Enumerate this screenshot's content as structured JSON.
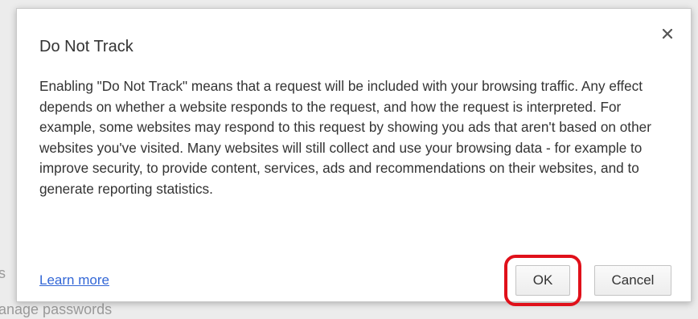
{
  "background": {
    "fragment_bottom": "anage passwords",
    "fragment_mid": "s"
  },
  "dialog": {
    "title": "Do Not Track",
    "close_icon": "close-icon",
    "body": "Enabling \"Do Not Track\" means that a request will be included with your browsing traffic. Any effect depends on whether a website responds to the request, and how the request is interpreted. For example, some websites may respond to this request by showing you ads that aren't based on other websites you've visited. Many websites will still collect and use your browsing data - for example to improve security, to provide content, services, ads and recommendations on their websites, and to generate reporting statistics.",
    "learn_more_label": "Learn more",
    "ok_label": "OK",
    "cancel_label": "Cancel"
  },
  "colors": {
    "link": "#3367d6",
    "highlight": "#e0101a",
    "text": "#333333"
  }
}
